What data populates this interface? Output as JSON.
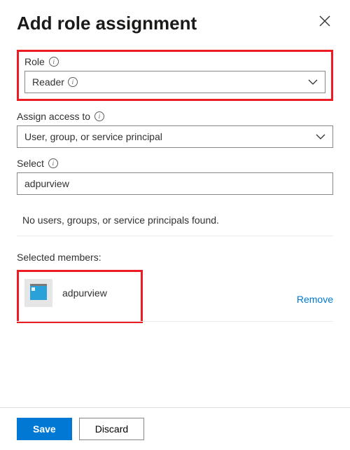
{
  "header": {
    "title": "Add role assignment"
  },
  "fields": {
    "role": {
      "label": "Role",
      "value": "Reader"
    },
    "assign_access": {
      "label": "Assign access to",
      "value": "User, group, or service principal"
    },
    "select": {
      "label": "Select",
      "value": "adpurview"
    }
  },
  "results": {
    "empty": "No users, groups, or service principals found."
  },
  "selected": {
    "label": "Selected members:",
    "members": [
      {
        "name": "adpurview"
      }
    ],
    "remove": "Remove"
  },
  "footer": {
    "save": "Save",
    "discard": "Discard"
  }
}
